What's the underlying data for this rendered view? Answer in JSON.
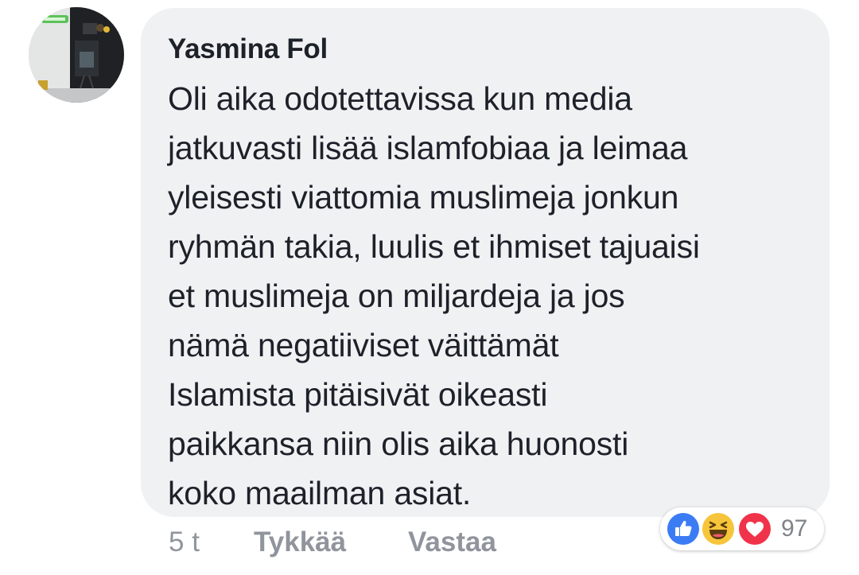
{
  "comment": {
    "author": "Yasmina Fol",
    "lines": [
      "Oli aika odotettavissa kun media",
      "jatkuvasti lisää islamfobiaa ja leimaa",
      "yleisesti viattomia muslimeja jonkun",
      "ryhmän takia, luulis et ihmiset tajuaisi",
      "et muslimeja on miljardeja ja jos",
      "nämä negatiiviset väittämät",
      "Islamista pitäisivät oikeasti",
      "paikkansa niin olis aika huonosti",
      "koko maailman asiat."
    ]
  },
  "meta": {
    "time": "5 t",
    "like_label": "Tykkää",
    "reply_label": "Vastaa"
  },
  "reactions": {
    "icons": [
      "like-icon",
      "haha-icon",
      "love-icon"
    ],
    "count": "97",
    "colors": {
      "like": "#3b7cf5",
      "haha": "#f7c53b",
      "love": "#f0334a"
    }
  },
  "colors": {
    "bubble": "#f0f1f3",
    "text": "#1d2129",
    "meta": "#90949c"
  }
}
